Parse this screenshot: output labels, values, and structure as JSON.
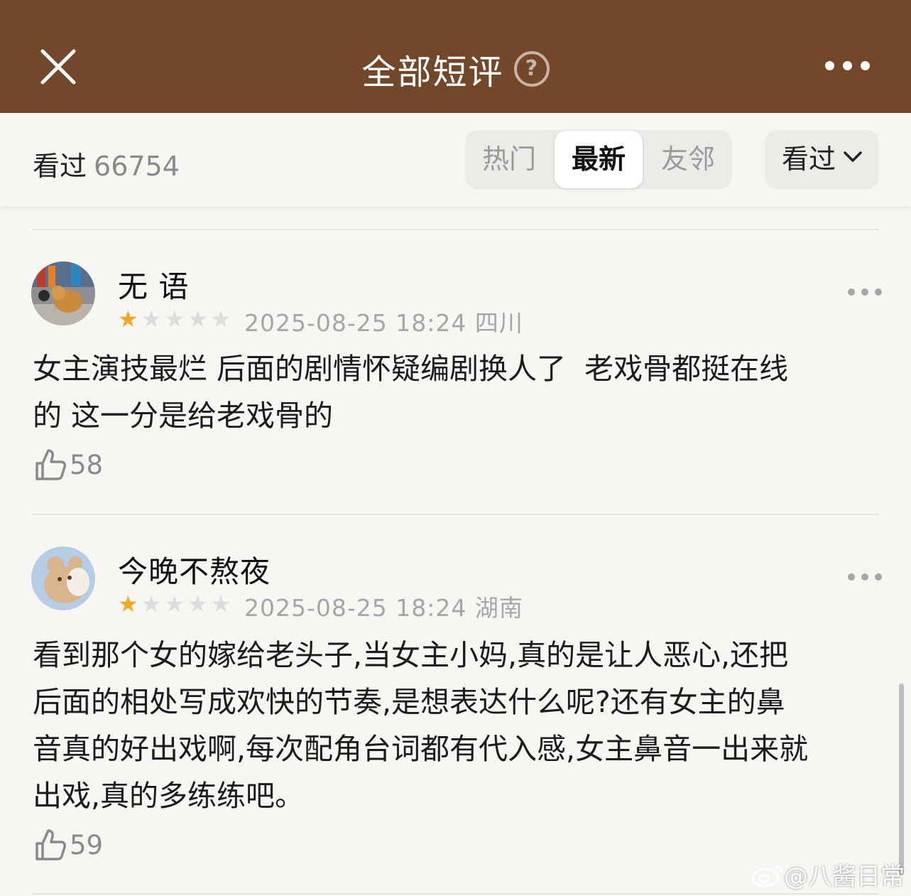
{
  "header": {
    "title": "全部短评",
    "help_icon": "question-circle-icon",
    "close_icon": "close-icon",
    "more_icon": "more-horizontal-icon",
    "background_color": "#73472a"
  },
  "filter": {
    "count_label": "看过",
    "count_value": "66754",
    "tabs": [
      {
        "label": "热门",
        "active": false
      },
      {
        "label": "最新",
        "active": true
      },
      {
        "label": "友邻",
        "active": false
      }
    ],
    "dropdown_label": "看过",
    "dropdown_icon": "chevron-down-icon"
  },
  "comments": [
    {
      "username": "无 语",
      "rating": 1,
      "rating_max": 5,
      "datetime": "2025-08-25 18:24",
      "location": "四川",
      "text": "女主演技最烂 后面的剧情怀疑编剧换人了  老戏骨都挺在线\n的 这一分是给老戏骨的",
      "likes": "58"
    },
    {
      "username": "今晚不熬夜",
      "rating": 1,
      "rating_max": 5,
      "datetime": "2025-08-25 18:24",
      "location": "湖南",
      "text": "看到那个女的嫁给老头子,当女主小妈,真的是让人恶心,还把\n后面的相处写成欢快的节奏,是想表达什么呢?还有女主的鼻\n音真的好出戏啊,每次配角台词都有代入感,女主鼻音一出来就\n出戏,真的多练练吧。",
      "likes": "59"
    }
  ],
  "colors": {
    "star_filled": "#f5a623",
    "star_empty": "#dcdcdc"
  },
  "watermark": {
    "text": "@八酱日常",
    "icon": "weibo-icon"
  }
}
